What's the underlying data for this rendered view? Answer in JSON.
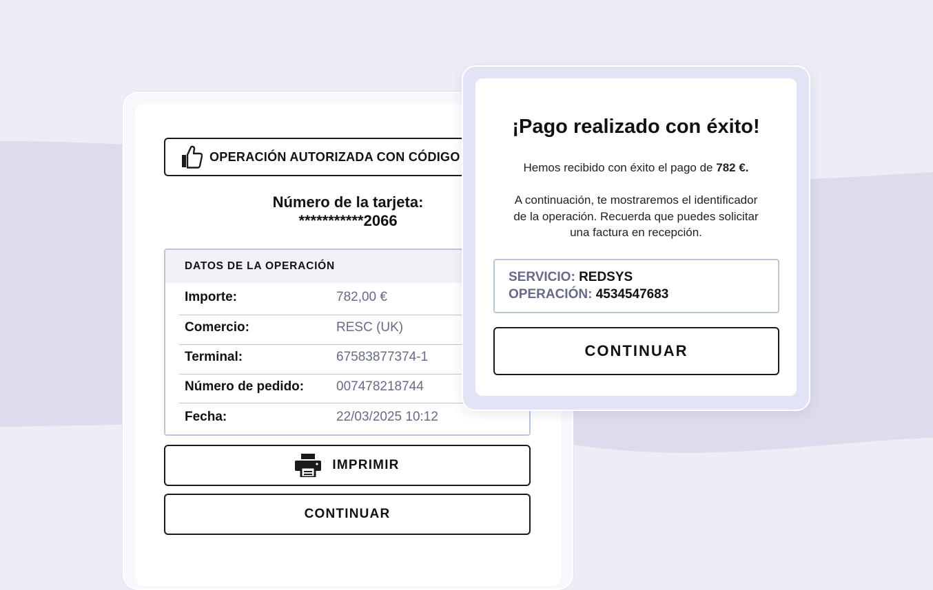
{
  "receipt": {
    "auth_banner": "OPERACIÓN AUTORIZADA CON CÓDIGO",
    "card_label": "Número de la tarjeta:",
    "card_number": "***********2066",
    "ops_title": "DATOS DE LA OPERACIÓN",
    "rows": [
      {
        "label": "Importe:",
        "value": "782,00 €"
      },
      {
        "label": "Comercio:",
        "value": "RESC (UK)"
      },
      {
        "label": "Terminal:",
        "value": "67583877374-1"
      },
      {
        "label": "Número de pedido:",
        "value": "007478218744"
      },
      {
        "label": "Fecha:",
        "value": "22/03/2025 10:12"
      }
    ],
    "print_button": "IMPRIMIR",
    "continue_button": "CONTINUAR"
  },
  "success": {
    "title": "¡Pago realizado con éxito!",
    "received_prefix": "Hemos recibido con éxito el pago de ",
    "received_amount": "782 €.",
    "info_line1": "A continuación, te mostraremos el identificador",
    "info_line2": "de la operación. Recuerda que puedes solicitar",
    "info_line3": "una factura en recepción.",
    "service_label": "SERVICIO: ",
    "service_value": "REDSYS",
    "operation_label": "OPERACIÓN: ",
    "operation_value": "4534547683",
    "continue_button": "CONTINUAR"
  },
  "colors": {
    "background": "#ededf6",
    "wave": "#dcdcec",
    "border_accent": "#b9c6d8",
    "value_text": "#666a86",
    "success_frame": "#e3e3f6"
  },
  "icons": [
    "thumbs-up-icon",
    "printer-icon"
  ]
}
